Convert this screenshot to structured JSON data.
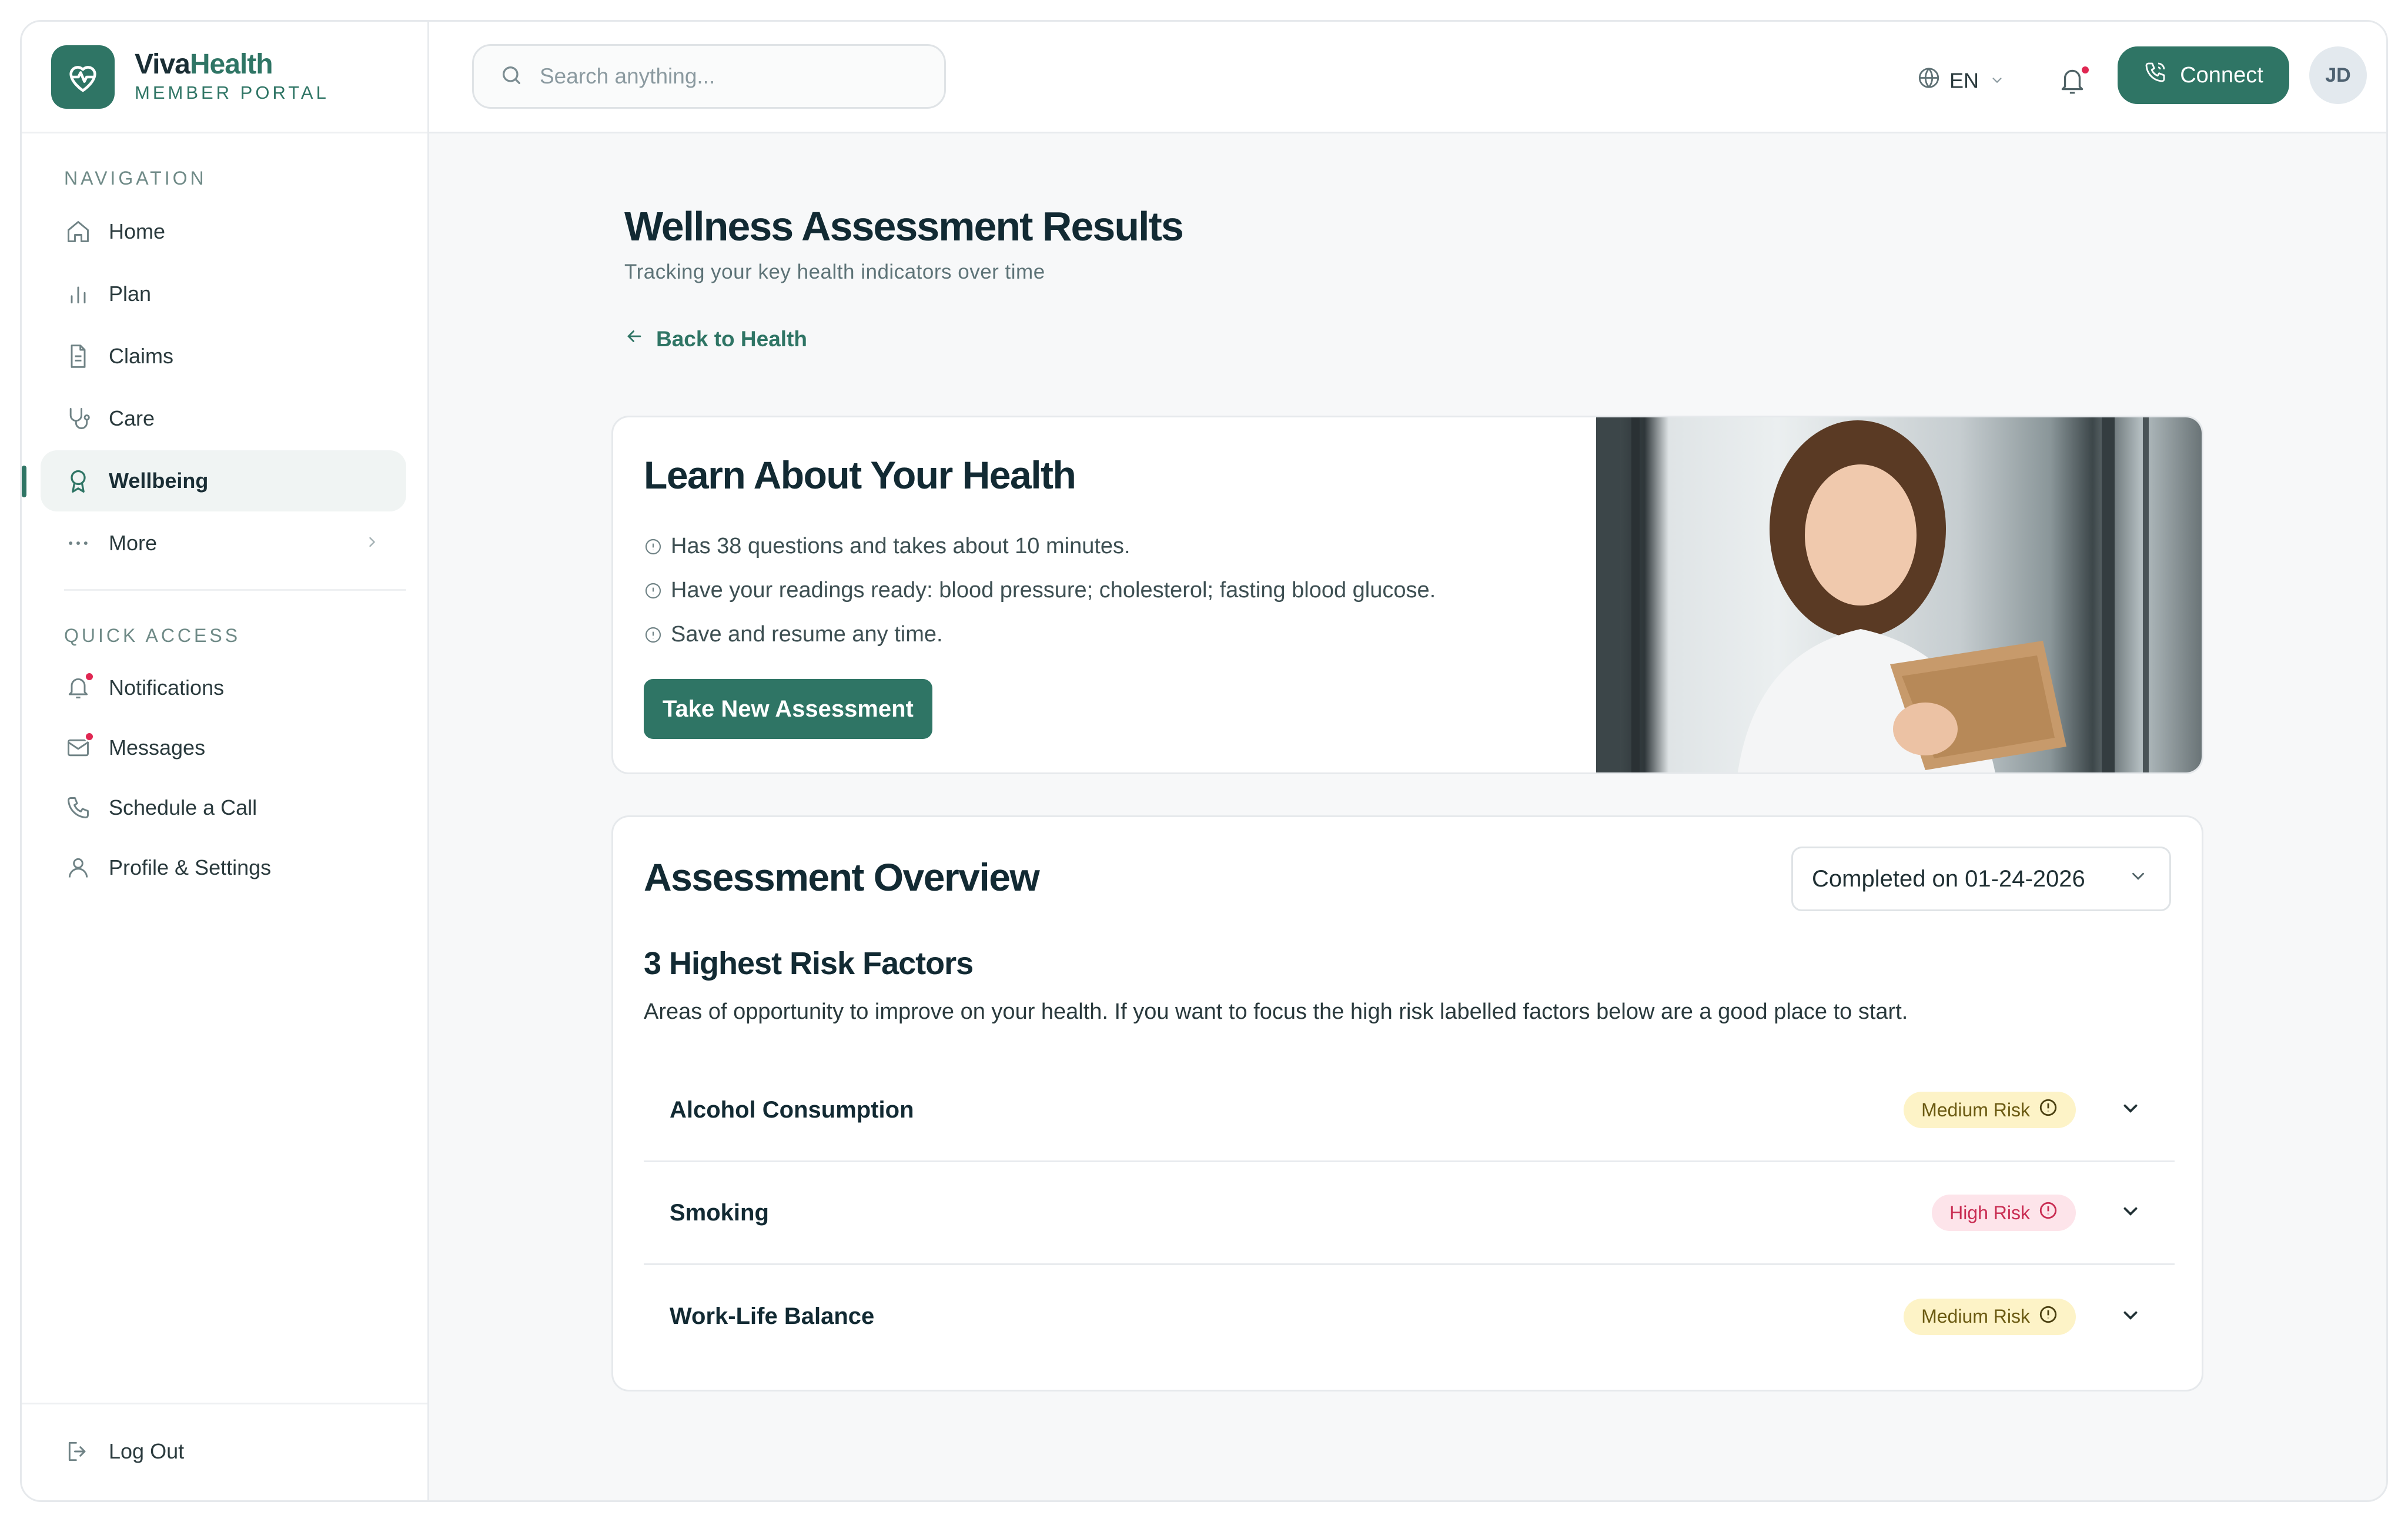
{
  "brand": {
    "name_prefix": "Viva",
    "name_suffix": "Health",
    "subtitle": "MEMBER PORTAL"
  },
  "sidebar": {
    "navigation_title": "NAVIGATION",
    "nav_items": [
      {
        "label": "Home",
        "icon": "home-icon"
      },
      {
        "label": "Plan",
        "icon": "bar-chart-icon"
      },
      {
        "label": "Claims",
        "icon": "document-icon"
      },
      {
        "label": "Care",
        "icon": "stethoscope-icon"
      },
      {
        "label": "Wellbeing",
        "icon": "award-icon",
        "active": true
      },
      {
        "label": "More",
        "icon": "more-dots-icon"
      }
    ],
    "quick_access_title": "QUICK ACCESS",
    "quick_items": [
      {
        "label": "Notifications",
        "icon": "bell-icon",
        "badge": true
      },
      {
        "label": "Messages",
        "icon": "mail-icon",
        "badge": true
      },
      {
        "label": "Schedule a Call",
        "icon": "phone-icon"
      },
      {
        "label": "Profile & Settings",
        "icon": "user-icon"
      }
    ],
    "logout_label": "Log Out"
  },
  "topbar": {
    "search_placeholder": "Search anything...",
    "language": "EN",
    "connect_label": "Connect",
    "avatar_initials": "JD"
  },
  "page": {
    "title": "Wellness Assessment Results",
    "subtitle": "Tracking your key health indicators over time",
    "back_label": "Back to Health"
  },
  "learn_card": {
    "title": "Learn About Your Health",
    "points": [
      "Has 38 questions and takes about 10 minutes.",
      "Have your readings ready: blood pressure; cholesterol; fasting blood glucose.",
      "Save and resume any time."
    ],
    "button_label": "Take New Assessment"
  },
  "overview": {
    "title": "Assessment Overview",
    "selected_date": "Completed on 01-24-2026",
    "risk_title": "3 Highest Risk Factors",
    "risk_description": "Areas of opportunity to improve on your health. If you want to focus the high risk labelled factors below are a good place to start.",
    "risks": [
      {
        "name": "Alcohol Consumption",
        "level": "Medium Risk",
        "severity": "medium"
      },
      {
        "name": "Smoking",
        "level": "High Risk",
        "severity": "high"
      },
      {
        "name": "Work-Life Balance",
        "level": "Medium Risk",
        "severity": "medium"
      }
    ]
  },
  "colors": {
    "accent": "#2f7565",
    "notification_dot": "#e02752",
    "medium_badge_bg": "#fdf3c7",
    "high_badge_bg": "#fde4ea"
  }
}
